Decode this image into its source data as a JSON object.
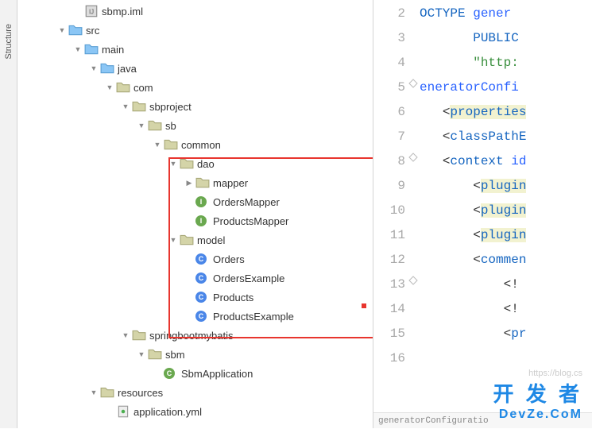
{
  "sidebarTab": "Structure",
  "tree": [
    {
      "depth": 2,
      "arrow": "none",
      "iconType": "iml",
      "label": "sbmp.iml"
    },
    {
      "depth": 1,
      "arrow": "expanded",
      "iconType": "src-folder",
      "label": "src"
    },
    {
      "depth": 2,
      "arrow": "expanded",
      "iconType": "src-folder",
      "label": "main"
    },
    {
      "depth": 3,
      "arrow": "expanded",
      "iconType": "src-folder",
      "label": "java"
    },
    {
      "depth": 4,
      "arrow": "expanded",
      "iconType": "package",
      "label": "com"
    },
    {
      "depth": 5,
      "arrow": "expanded",
      "iconType": "package",
      "label": "sbproject"
    },
    {
      "depth": 6,
      "arrow": "expanded",
      "iconType": "package",
      "label": "sb"
    },
    {
      "depth": 7,
      "arrow": "expanded",
      "iconType": "package",
      "label": "common"
    },
    {
      "depth": 8,
      "arrow": "expanded",
      "iconType": "package",
      "label": "dao"
    },
    {
      "depth": 9,
      "arrow": "collapsed",
      "iconType": "package",
      "label": "mapper"
    },
    {
      "depth": 9,
      "arrow": "none",
      "iconType": "interface",
      "label": "OrdersMapper"
    },
    {
      "depth": 9,
      "arrow": "none",
      "iconType": "interface",
      "label": "ProductsMapper"
    },
    {
      "depth": 8,
      "arrow": "expanded",
      "iconType": "package",
      "label": "model"
    },
    {
      "depth": 9,
      "arrow": "none",
      "iconType": "class",
      "label": "Orders"
    },
    {
      "depth": 9,
      "arrow": "none",
      "iconType": "class",
      "label": "OrdersExample"
    },
    {
      "depth": 9,
      "arrow": "none",
      "iconType": "class",
      "label": "Products"
    },
    {
      "depth": 9,
      "arrow": "none",
      "iconType": "class",
      "label": "ProductsExample"
    },
    {
      "depth": 5,
      "arrow": "expanded",
      "iconType": "package",
      "label": "springbootmybatis"
    },
    {
      "depth": 6,
      "arrow": "expanded",
      "iconType": "package",
      "label": "sbm"
    },
    {
      "depth": 7,
      "arrow": "none",
      "iconType": "class-spring",
      "label": "SbmApplication"
    },
    {
      "depth": 3,
      "arrow": "expanded",
      "iconType": "res-folder",
      "label": "resources"
    },
    {
      "depth": 4,
      "arrow": "none",
      "iconType": "yml",
      "label": "application.yml"
    }
  ],
  "lineNumbers": [
    "2",
    "3",
    "4",
    "5",
    "6",
    "7",
    "8",
    "9",
    "10",
    "11",
    "12",
    "13",
    "14",
    "15",
    "16"
  ],
  "codeLines": [
    {
      "html": "<span class='kw'>OCTYPE</span> <span class='attr'>gener</span>"
    },
    {
      "html": "       <span class='kw'>PUBLIC</span> "
    },
    {
      "html": "       <span class='str'>\"http:</span>"
    },
    {
      "html": "<span class='attr'>eneratorConfi</span>"
    },
    {
      "html": "   <span class='txt'>&lt;</span><span class='hl'><span class='kw'>properties</span></span>"
    },
    {
      "html": "   <span class='txt'>&lt;</span><span class='kw'>classPathE</span>"
    },
    {
      "html": "   <span class='txt'>&lt;</span><span class='kw'>context</span> <span class='attr'>id</span>"
    },
    {
      "html": "       <span class='txt'>&lt;</span><span class='hl'><span class='kw'>plugin</span></span>"
    },
    {
      "html": "       <span class='txt'>&lt;</span><span class='hl'><span class='kw'>plugin</span></span>"
    },
    {
      "html": "       <span class='txt'>&lt;</span><span class='hl'><span class='kw'>plugin</span></span>"
    },
    {
      "html": "       <span class='txt'>&lt;</span><span class='kw'>commen</span>"
    },
    {
      "html": "           <span class='txt'>&lt;!</span>"
    },
    {
      "html": "           <span class='txt'>&lt;!</span>"
    },
    {
      "html": "           <span class='txt'>&lt;</span><span class='kw'>pr</span>"
    },
    {
      "html": ""
    }
  ],
  "breadcrumb": "generatorConfiguratio",
  "watermark": {
    "url": "https://blog.cs",
    "brand1": "开 发 者",
    "brand2": "DevZe.CoM"
  }
}
